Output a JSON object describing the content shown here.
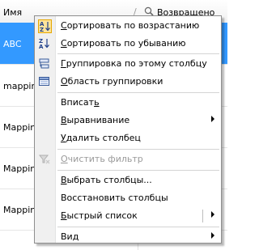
{
  "grid": {
    "header": {
      "name": "Имя",
      "returned": "Возвращено"
    },
    "rows": [
      "ABC",
      "mapping",
      "Mapping",
      "Mapping",
      "Mapping"
    ]
  },
  "menu": {
    "items": [
      {
        "label": "Сортировать по возрастанию",
        "underline": "С",
        "rest": "ортировать по возрастанию",
        "icon": "sort-ascending-icon"
      },
      {
        "label": "Сортировать по убыванию",
        "underline": "С",
        "rest": "ортировать по убыванию",
        "icon": "sort-descending-icon"
      },
      {
        "label": "Группировка по этому столбцу",
        "underline": "Г",
        "rest": "руппировка по этому столбцу",
        "icon": "group-by-column-icon"
      },
      {
        "label": "Область группировки",
        "underline": "О",
        "rest": "бласть группировки",
        "icon": "group-area-icon"
      },
      {
        "label": "Вписать",
        "pre": "Вписат",
        "underline": "ь",
        "rest": ""
      },
      {
        "label": "Выравнивание",
        "underline": "В",
        "rest": "ыравнивание"
      },
      {
        "label": "Удалить столбец",
        "underline": "У",
        "rest": "далить столбец"
      },
      {
        "label": "Очистить фильтр",
        "underline": "О",
        "rest": "чистить фильтр",
        "icon": "clear-filter-icon"
      },
      {
        "label": "Выбрать столбцы...",
        "underline": "В",
        "rest": "ыбрать столбцы..."
      },
      {
        "label": "Восстановить столбцы",
        "underline": "",
        "rest": "Восстановить столбцы"
      },
      {
        "label": "Быстрый список",
        "underline": "Б",
        "rest": "ыстрый список"
      },
      {
        "label": "Вид",
        "pre": "Ви",
        "underline": "д",
        "rest": ""
      }
    ]
  }
}
